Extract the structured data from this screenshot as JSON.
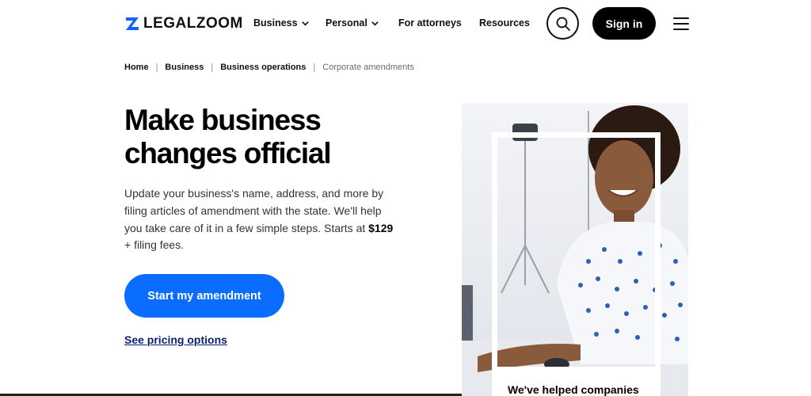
{
  "brand": {
    "name": "LEGALZOOM",
    "accent": "#0a6dff",
    "logo_color": "#1560ff"
  },
  "nav": {
    "items": [
      {
        "label": "Business",
        "has_dropdown": true
      },
      {
        "label": "Personal",
        "has_dropdown": true
      },
      {
        "label": "For attorneys",
        "has_dropdown": false
      },
      {
        "label": "Resources",
        "has_dropdown": false
      }
    ],
    "search_icon": "search-icon",
    "signin_label": "Sign in",
    "menu_icon": "hamburger-menu-icon"
  },
  "breadcrumb": {
    "items": [
      {
        "label": "Home"
      },
      {
        "label": "Business"
      },
      {
        "label": "Business operations"
      },
      {
        "label": "Corporate amendments"
      }
    ]
  },
  "hero": {
    "title_line1": "Make business",
    "title_line2": "changes official",
    "desc_prefix": "Update your business's name, address, and more by filing articles of amendment with the state. We'll help you take care of it in a few simple steps. Starts at ",
    "desc_price": "$129",
    "desc_suffix": " + filing fees.",
    "cta_label": "Start my amendment",
    "pricing_link": "See pricing options"
  },
  "photo_card": {
    "text": "We've helped companies"
  }
}
